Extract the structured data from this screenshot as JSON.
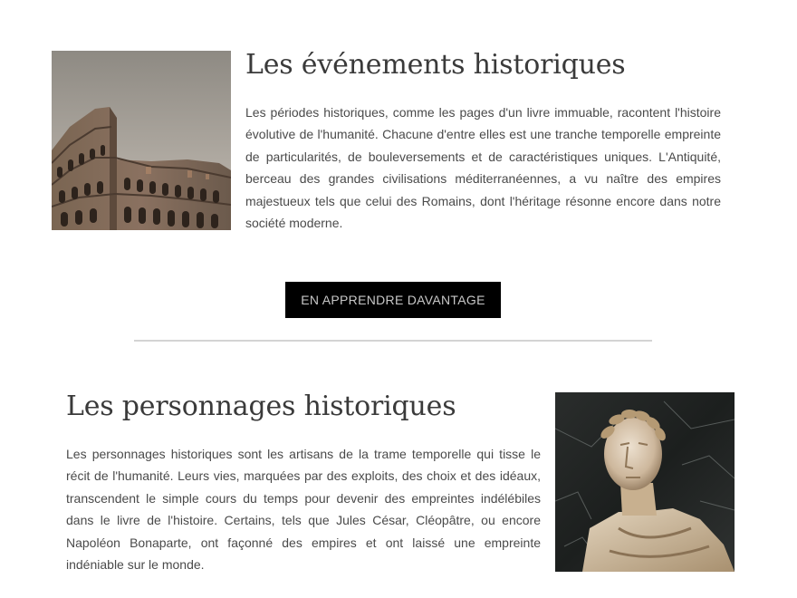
{
  "events": {
    "title": "Les événements historiques",
    "text": "Les périodes historiques, comme les pages d'un livre immuable, racontent l'histoire évolutive de l'humanité. Chacune d'entre elles est une tranche temporelle empreinte de particularités, de bouleversements et de caractéristiques uniques. L'Antiquité, berceau des grandes civilisations méditerranéennes, a vu naître des empires majestueux tels que celui des Romains, dont l'héritage résonne encore dans notre société moderne.",
    "image": "colosseum-photo"
  },
  "cta": {
    "label": "EN APPRENDRE DAVANTAGE"
  },
  "people": {
    "title": "Les personnages historiques",
    "text": "Les personnages historiques sont les artisans de la trame temporelle qui tisse le récit de l'humanité. Leurs vies, marquées par des exploits, des choix et des idéaux, transcendent le simple cours du temps pour devenir des empreintes indélébiles dans le livre de l'histoire. Certains, tels que Jules César, Cléopâtre, ou encore Napoléon Bonaparte, ont façonné des empires et ont laissé une empreinte indéniable sur le monde.",
    "image": "caesar-bust-photo"
  },
  "colors": {
    "button_bg": "#000000",
    "button_text": "#c8c8c8",
    "title": "#3a3a3a",
    "body_text": "#4a4a4a",
    "divider": "#d4d4d4"
  }
}
